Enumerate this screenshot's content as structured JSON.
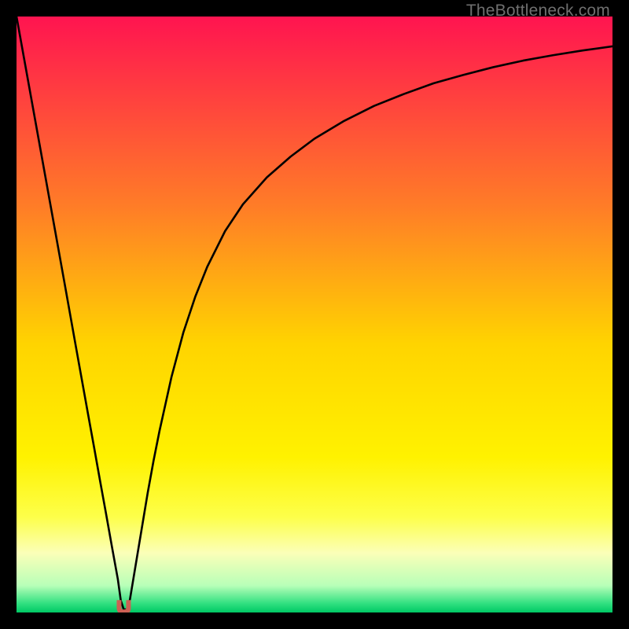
{
  "watermark": "TheBottleneck.com",
  "chart_data": {
    "type": "line",
    "title": "",
    "xlabel": "",
    "ylabel": "",
    "xlim": [
      0,
      100
    ],
    "ylim": [
      0,
      100
    ],
    "x_values": [
      0,
      2,
      4,
      6,
      8,
      10,
      12,
      13,
      14,
      15,
      16,
      17,
      17.5,
      18,
      18.5,
      19,
      20,
      21,
      22,
      23,
      24,
      26,
      28,
      30,
      32,
      35,
      38,
      42,
      46,
      50,
      55,
      60,
      65,
      70,
      75,
      80,
      85,
      90,
      95,
      100
    ],
    "y_values": [
      100,
      88.9,
      77.8,
      66.7,
      55.6,
      44.4,
      33.3,
      27.8,
      22.2,
      16.7,
      11.1,
      5.6,
      2.0,
      0.5,
      0.5,
      2.0,
      8.0,
      14.0,
      20.0,
      25.5,
      30.5,
      39.5,
      47.0,
      53.0,
      58.0,
      64.0,
      68.5,
      73.0,
      76.5,
      79.5,
      82.5,
      85.0,
      87.0,
      88.8,
      90.2,
      91.5,
      92.6,
      93.5,
      94.3,
      95.0
    ],
    "marker": {
      "x": 18,
      "y": 0.5,
      "color": "#cc6054"
    },
    "background_gradient": {
      "stops": [
        {
          "offset": 0.0,
          "color": "#ff1450"
        },
        {
          "offset": 0.32,
          "color": "#ff7d27"
        },
        {
          "offset": 0.55,
          "color": "#ffd400"
        },
        {
          "offset": 0.74,
          "color": "#fff200"
        },
        {
          "offset": 0.84,
          "color": "#fdff4a"
        },
        {
          "offset": 0.9,
          "color": "#fbffb8"
        },
        {
          "offset": 0.955,
          "color": "#b8ffb8"
        },
        {
          "offset": 0.985,
          "color": "#30e080"
        },
        {
          "offset": 1.0,
          "color": "#00c864"
        }
      ]
    }
  }
}
